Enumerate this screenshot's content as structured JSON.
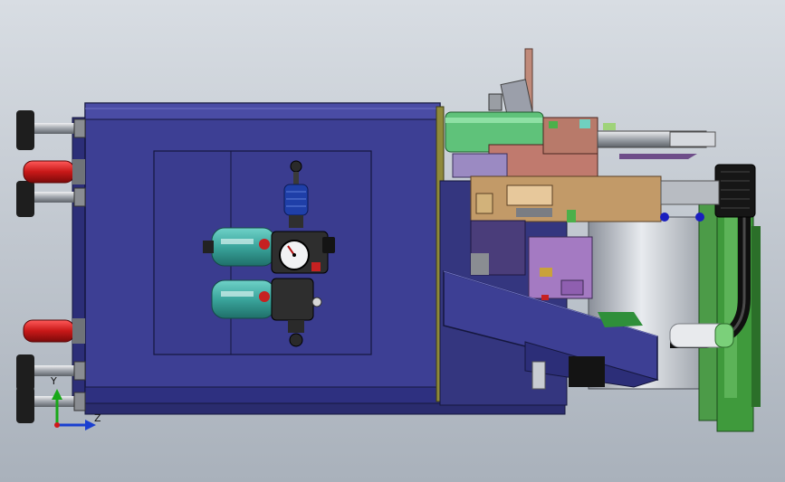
{
  "viewport": {
    "background_top": "#d8dde3",
    "background_bottom": "#a9b1bb"
  },
  "triad": {
    "axis_y_label": "Y",
    "axis_z_label": "Z",
    "axis_y_color": "#18a818",
    "axis_z_color": "#1a3fd0",
    "axis_x_color": "#d01818"
  },
  "colors": {
    "cabinet": "#3d3f94",
    "cabinet_dark": "#23256a",
    "cabinet_edge": "#15173e",
    "filter_bowl": "#4ab3ab",
    "regulator": "#2e2e2e",
    "caster_wheel": "#d02020",
    "motor_green": "#3f9a3c",
    "hood_green": "#5fc27a",
    "mount_tan": "#c29a68",
    "mechanism_purple": "#a47ac2",
    "chrome": "#c9ccd1"
  }
}
